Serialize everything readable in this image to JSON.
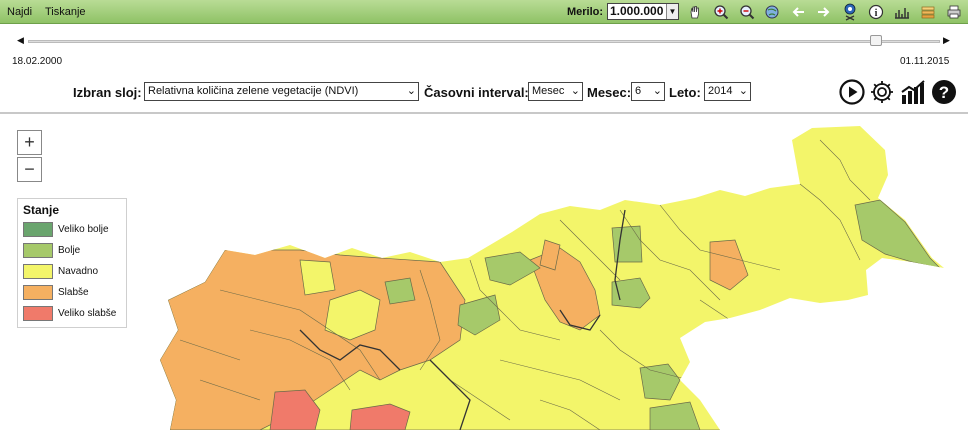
{
  "menu": {
    "find": "Najdi",
    "print": "Tiskanje"
  },
  "scale": {
    "label": "Merilo:",
    "value": "1.000.000"
  },
  "timeline": {
    "start_date": "18.02.2000",
    "end_date": "01.11.2015",
    "position_fraction": 0.93
  },
  "controls": {
    "layer_label": "Izbran sloj:",
    "layer_value": "Relativna količina zelene vegetacije (NDVI)",
    "interval_label": "Časovni interval:",
    "interval_value": "Mesec",
    "month_label": "Mesec:",
    "month_value": "6",
    "year_label": "Leto:",
    "year_value": "2014"
  },
  "map": {
    "zoom_in": "+",
    "zoom_out": "−",
    "legend": {
      "title": "Stanje",
      "items": [
        {
          "label": "Veliko bolje",
          "color": "#6aa56e"
        },
        {
          "label": "Bolje",
          "color": "#a6c96a"
        },
        {
          "label": "Navadno",
          "color": "#f3f56a"
        },
        {
          "label": "Slabše",
          "color": "#f5b061"
        },
        {
          "label": "Veliko slabše",
          "color": "#f07a6a"
        }
      ]
    }
  },
  "toolbar_icons": [
    "pan-icon",
    "zoom-in-icon",
    "zoom-out-icon",
    "full-extent-icon",
    "back-icon",
    "forward-icon",
    "identify-icon",
    "info-icon",
    "measure-icon",
    "layers-icon",
    "print-icon"
  ],
  "action_icons": [
    "play-icon",
    "settings-icon",
    "chart-icon",
    "help-icon"
  ]
}
